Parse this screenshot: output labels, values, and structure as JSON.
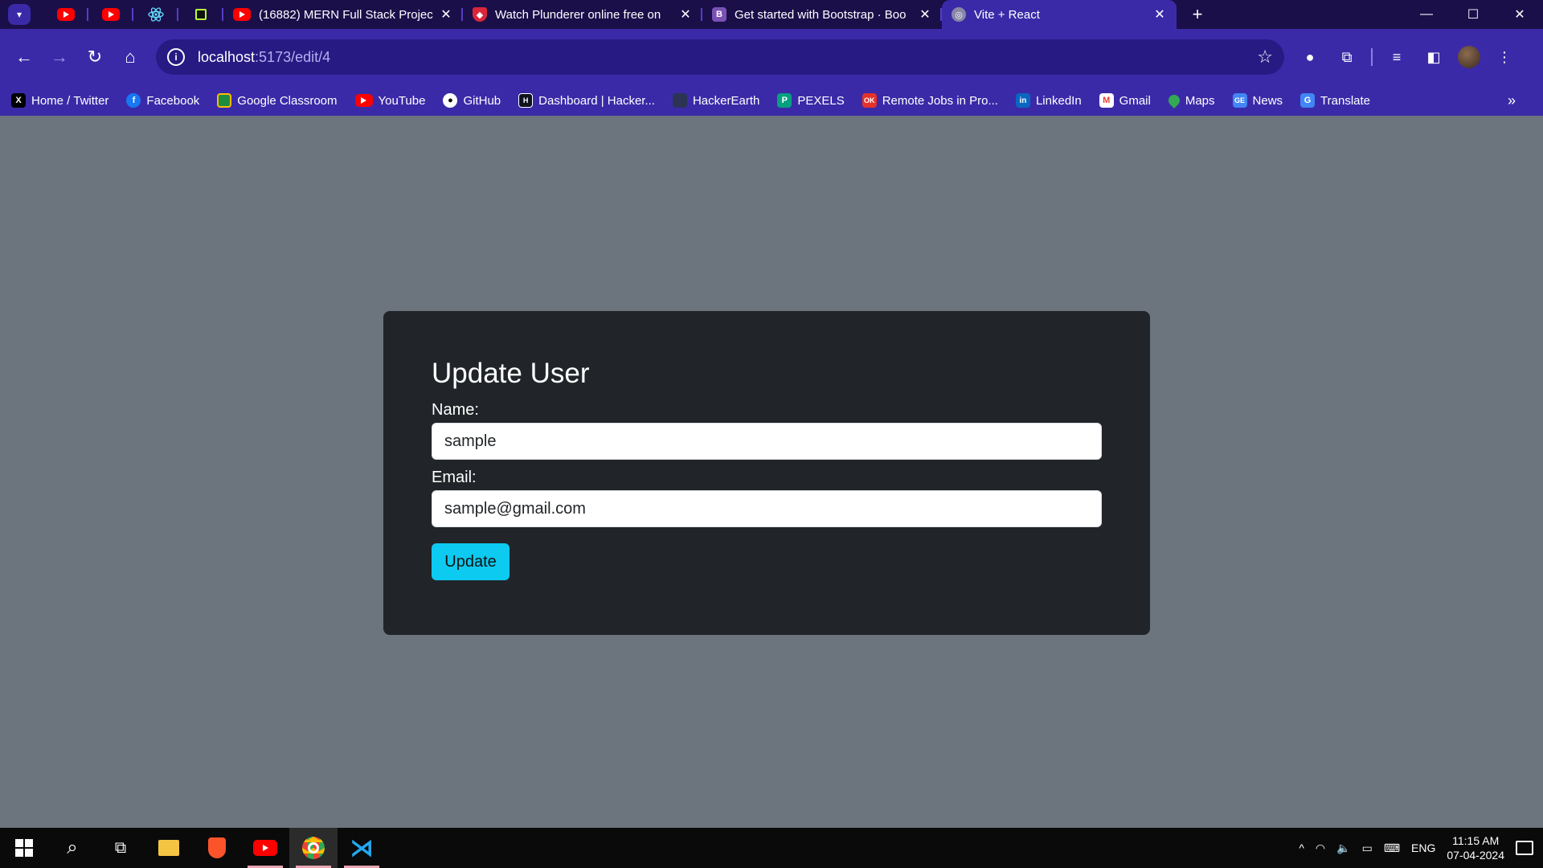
{
  "browser": {
    "tabs": [
      {
        "title": "(16882) MERN Full Stack Projec",
        "favicon": "youtube-icon"
      },
      {
        "title": "Watch Plunderer online free on",
        "favicon": "shield-icon"
      },
      {
        "title": "Get started with Bootstrap · Boo",
        "favicon": "bootstrap-icon"
      },
      {
        "title": "Vite + React",
        "favicon": "globe-icon",
        "active": true
      }
    ],
    "address": {
      "host": "localhost",
      "path": ":5173/edit/4"
    },
    "bookmarks": [
      {
        "label": "Home / Twitter",
        "icon": "x-icon"
      },
      {
        "label": "Facebook",
        "icon": "facebook-icon"
      },
      {
        "label": "Google Classroom",
        "icon": "classroom-icon"
      },
      {
        "label": "YouTube",
        "icon": "youtube-icon"
      },
      {
        "label": "GitHub",
        "icon": "github-icon"
      },
      {
        "label": "Dashboard | Hacker...",
        "icon": "hackerrank-icon"
      },
      {
        "label": "HackerEarth",
        "icon": "hackerearth-icon"
      },
      {
        "label": "PEXELS",
        "icon": "pexels-icon"
      },
      {
        "label": "Remote Jobs in Pro...",
        "icon": "ok-icon"
      },
      {
        "label": "LinkedIn",
        "icon": "linkedin-icon"
      },
      {
        "label": "Gmail",
        "icon": "gmail-icon"
      },
      {
        "label": "Maps",
        "icon": "maps-icon"
      },
      {
        "label": "News",
        "icon": "news-icon"
      },
      {
        "label": "Translate",
        "icon": "translate-icon"
      }
    ]
  },
  "form": {
    "title": "Update User",
    "name_label": "Name:",
    "name_value": "sample",
    "email_label": "Email:",
    "email_value": "sample@gmail.com",
    "submit_label": "Update"
  },
  "taskbar": {
    "language": "ENG",
    "time": "11:15 AM",
    "date": "07-04-2024"
  },
  "colors": {
    "page_bg": "#6c757d",
    "card_bg": "#212529",
    "button_bg": "#0dcaf0",
    "browser_accent": "#3b2aa8"
  }
}
